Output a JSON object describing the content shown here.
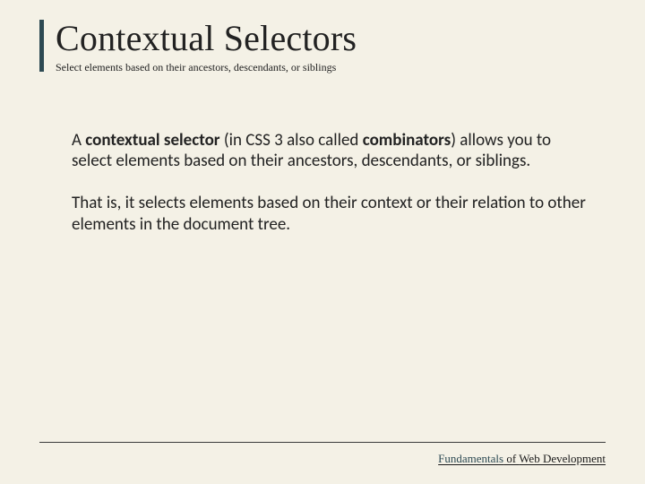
{
  "header": {
    "title": "Contextual Selectors",
    "subtitle": "Select elements based on their ancestors, descendants, or siblings"
  },
  "body": {
    "p1_prefix": "A ",
    "p1_term1": "contextual selector",
    "p1_mid1": " (in CSS 3 also called ",
    "p1_term2": "combinators",
    "p1_suffix": ") allows you to select elements based on their ancestors, descendants, or siblings.",
    "p2": "That is, it selects elements based on their context or their relation to other elements in the document tree."
  },
  "footer": {
    "brand1": "Fundamentals",
    "brand_sep": " of ",
    "brand2": "Web Development"
  }
}
